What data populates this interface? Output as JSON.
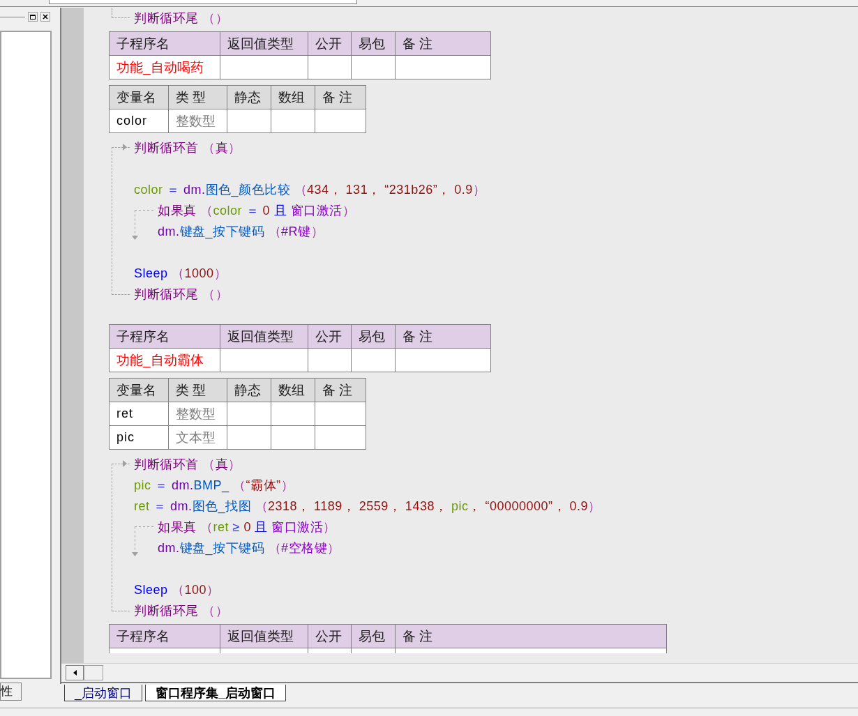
{
  "left_panel": {
    "tab": "性"
  },
  "code": [
    {
      "kind": "loop_tail",
      "tokens": [
        {
          "text": "判断循环尾",
          "kind": "flow"
        },
        {
          "text": " （）",
          "kind": "paren"
        }
      ]
    },
    {
      "kind": "sub_table",
      "columns": [
        "子程序名",
        "返回值类型",
        "公开",
        "易包",
        "备 注"
      ],
      "rows": [
        {
          "name": "功能_自动喝药"
        }
      ]
    },
    {
      "kind": "var_table",
      "columns": [
        "变量名",
        "类 型",
        "静态",
        "数组",
        "备 注"
      ],
      "rows": [
        {
          "name": "color",
          "type": "整数型"
        }
      ]
    },
    {
      "kind": "loop",
      "head": [
        {
          "text": "判断循环首",
          "kind": "flow"
        },
        {
          "text": " （",
          "kind": "paren"
        },
        {
          "text": "真",
          "kind": "flow"
        },
        {
          "text": "）",
          "kind": "paren"
        }
      ],
      "body": [
        {
          "kind": "blank"
        },
        {
          "kind": "stmt",
          "tokens": [
            {
              "text": "color",
              "kind": "var"
            },
            {
              "text": " ＝ ",
              "kind": "op"
            },
            {
              "text": "dm.",
              "kind": "obj"
            },
            {
              "text": "图色_颜色比较",
              "kind": "method"
            },
            {
              "text": " （",
              "kind": "paren"
            },
            {
              "text": "434， 131， “231b26”， 0.9",
              "kind": "num"
            },
            {
              "text": "）",
              "kind": "paren"
            }
          ]
        },
        {
          "kind": "if",
          "head": [
            {
              "text": "如果真",
              "kind": "flow"
            },
            {
              "text": " （",
              "kind": "paren"
            },
            {
              "text": "color",
              "kind": "var"
            },
            {
              "text": " ＝ ",
              "kind": "op"
            },
            {
              "text": "0",
              "kind": "num"
            },
            {
              "text": " 且 ",
              "kind": "sys"
            },
            {
              "text": "窗口激活",
              "kind": "const"
            },
            {
              "text": "）",
              "kind": "paren"
            }
          ],
          "body": [
            {
              "kind": "stmt",
              "tokens": [
                {
                  "text": "dm.",
                  "kind": "obj"
                },
                {
                  "text": "键盘_按下键码",
                  "kind": "method"
                },
                {
                  "text": " （",
                  "kind": "paren"
                },
                {
                  "text": "#R键",
                  "kind": "const"
                },
                {
                  "text": "）",
                  "kind": "paren"
                }
              ]
            }
          ]
        },
        {
          "kind": "blank"
        },
        {
          "kind": "stmt",
          "tokens": [
            {
              "text": "Sleep",
              "kind": "sys"
            },
            {
              "text": " （",
              "kind": "paren"
            },
            {
              "text": "1000",
              "kind": "num"
            },
            {
              "text": "）",
              "kind": "paren"
            }
          ]
        }
      ],
      "tail": [
        {
          "text": "判断循环尾",
          "kind": "flow"
        },
        {
          "text": " （）",
          "kind": "paren"
        }
      ]
    },
    {
      "kind": "gap"
    },
    {
      "kind": "sub_table",
      "columns": [
        "子程序名",
        "返回值类型",
        "公开",
        "易包",
        "备 注"
      ],
      "rows": [
        {
          "name": "功能_自动霸体"
        }
      ]
    },
    {
      "kind": "var_table",
      "columns": [
        "变量名",
        "类 型",
        "静态",
        "数组",
        "备 注"
      ],
      "rows": [
        {
          "name": "ret",
          "type": "整数型"
        },
        {
          "name": "pic",
          "type": "文本型"
        }
      ]
    },
    {
      "kind": "loop",
      "head": [
        {
          "text": "判断循环首",
          "kind": "flow"
        },
        {
          "text": " （",
          "kind": "paren"
        },
        {
          "text": "真",
          "kind": "flow"
        },
        {
          "text": "）",
          "kind": "paren"
        }
      ],
      "body": [
        {
          "kind": "stmt",
          "tokens": [
            {
              "text": "pic",
              "kind": "var"
            },
            {
              "text": " ＝ ",
              "kind": "op"
            },
            {
              "text": "dm.",
              "kind": "obj"
            },
            {
              "text": "BMP_",
              "kind": "method"
            },
            {
              "text": " （",
              "kind": "paren"
            },
            {
              "text": "“霸体”",
              "kind": "num"
            },
            {
              "text": "）",
              "kind": "paren"
            }
          ]
        },
        {
          "kind": "stmt",
          "tokens": [
            {
              "text": "ret",
              "kind": "var"
            },
            {
              "text": " ＝ ",
              "kind": "op"
            },
            {
              "text": "dm.",
              "kind": "obj"
            },
            {
              "text": "图色_找图",
              "kind": "method"
            },
            {
              "text": " （",
              "kind": "paren"
            },
            {
              "text": "2318， 1189， 2559， 1438， ",
              "kind": "num"
            },
            {
              "text": "pic",
              "kind": "var"
            },
            {
              "text": "， “00000000”， 0.9",
              "kind": "num"
            },
            {
              "text": "）",
              "kind": "paren"
            }
          ]
        },
        {
          "kind": "if",
          "head": [
            {
              "text": "如果真",
              "kind": "flow"
            },
            {
              "text": " （",
              "kind": "paren"
            },
            {
              "text": "ret",
              "kind": "var"
            },
            {
              "text": " ≥ ",
              "kind": "op"
            },
            {
              "text": "0",
              "kind": "num"
            },
            {
              "text": " 且 ",
              "kind": "sys"
            },
            {
              "text": "窗口激活",
              "kind": "const"
            },
            {
              "text": "）",
              "kind": "paren"
            }
          ],
          "body": [
            {
              "kind": "stmt",
              "tokens": [
                {
                  "text": "dm.",
                  "kind": "obj"
                },
                {
                  "text": "键盘_按下键码",
                  "kind": "method"
                },
                {
                  "text": " （",
                  "kind": "paren"
                },
                {
                  "text": "#空格键",
                  "kind": "const"
                },
                {
                  "text": "）",
                  "kind": "paren"
                }
              ]
            }
          ]
        },
        {
          "kind": "blank"
        },
        {
          "kind": "stmt",
          "tokens": [
            {
              "text": "Sleep",
              "kind": "sys"
            },
            {
              "text": " （",
              "kind": "paren"
            },
            {
              "text": "100",
              "kind": "num"
            },
            {
              "text": "）",
              "kind": "paren"
            }
          ]
        }
      ],
      "tail": [
        {
          "text": "判断循环尾",
          "kind": "flow"
        },
        {
          "text": " （）",
          "kind": "paren"
        }
      ]
    },
    {
      "kind": "sub_table",
      "columns": [
        "子程序名",
        "返回值类型",
        "公开",
        "易包",
        "备 注"
      ],
      "note_wide": true,
      "cut_off": true
    }
  ],
  "tabs": [
    {
      "label": "_启动窗口",
      "selected": false
    },
    {
      "label": "窗口程序集_启动窗口",
      "selected": true
    }
  ]
}
